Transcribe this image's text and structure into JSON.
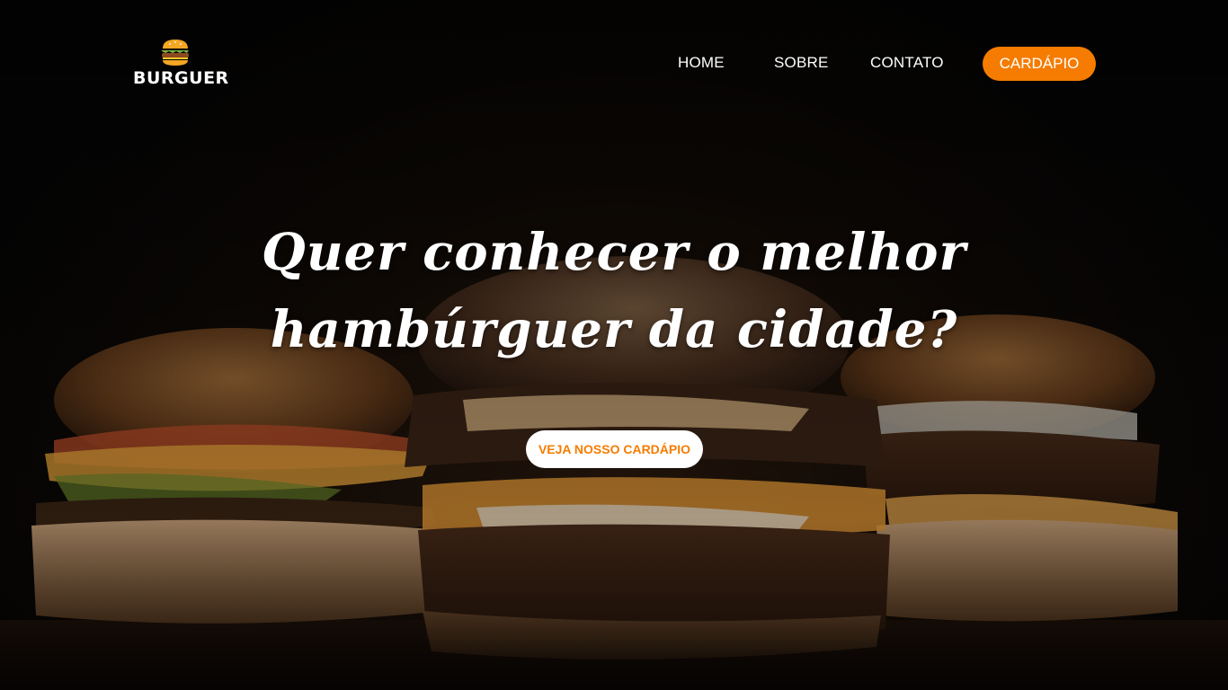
{
  "brand": {
    "name": "BURGUER",
    "icon": "burger-icon",
    "accent_color": "#f57c00"
  },
  "nav": {
    "items": [
      {
        "label": "HOME"
      },
      {
        "label": "SOBRE"
      },
      {
        "label": "CONTATO"
      }
    ],
    "cta_label": "CARDÁPIO"
  },
  "hero": {
    "headline_line1": "Quer conhecer o melhor",
    "headline_line2": "hambúrguer da cidade?",
    "cta_label": "VEJA NOSSO CARDÁPIO",
    "background_image": "three burgers on dark background"
  }
}
